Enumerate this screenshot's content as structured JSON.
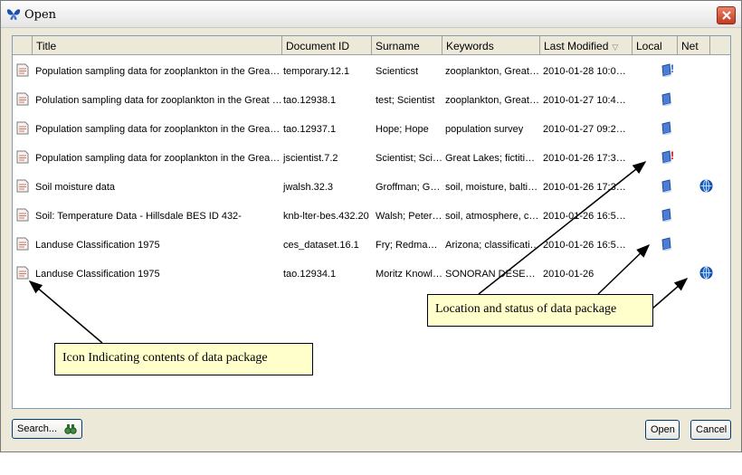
{
  "window": {
    "title": "Open",
    "app_icon": "butterfly-icon",
    "close_icon": "close-icon"
  },
  "table": {
    "columns": [
      {
        "key": "icon",
        "label": ""
      },
      {
        "key": "title",
        "label": "Title"
      },
      {
        "key": "doc_id",
        "label": "Document ID"
      },
      {
        "key": "surname",
        "label": "Surname"
      },
      {
        "key": "keywords",
        "label": "Keywords"
      },
      {
        "key": "modified",
        "label": "Last Modified"
      },
      {
        "key": "local",
        "label": "Local"
      },
      {
        "key": "net",
        "label": "Net"
      }
    ],
    "sort_icon": "▽",
    "rows": [
      {
        "title": "Population sampling data for zooplankton in the Great …",
        "doc_id": "temporary.12.1",
        "surname": "Scienticst",
        "keywords": "zooplankton, Great…",
        "modified": "2010-01-28 10:0…",
        "local": "local-warning",
        "net": ""
      },
      {
        "title": "Polulation sampling data for zooplankton in the Great …",
        "doc_id": "tao.12938.1",
        "surname": "test; Scientist",
        "keywords": "zooplankton, Great…",
        "modified": "2010-01-27 10:4…",
        "local": "local",
        "net": ""
      },
      {
        "title": "Population sampling data for zooplankton in the Great …",
        "doc_id": "tao.12937.1",
        "surname": "Hope; Hope",
        "keywords": "population survey",
        "modified": "2010-01-27 09:2…",
        "local": "local",
        "net": ""
      },
      {
        "title": "Population sampling data for zooplankton in the Great …",
        "doc_id": "jscientist.7.2",
        "surname": "Scientist; Sci…",
        "keywords": "Great Lakes; fictitio…",
        "modified": "2010-01-26 17:3…",
        "local": "local-error",
        "net": ""
      },
      {
        "title": "Soil moisture data",
        "doc_id": "jwalsh.32.3",
        "surname": "Groffman; G…",
        "keywords": "soil, moisture, balti…",
        "modified": "2010-01-26 17:3…",
        "local": "local",
        "net": "net"
      },
      {
        "title": "Soil: Temperature Data - Hillsdale BES ID 432-",
        "doc_id": "knb-lter-bes.432.20",
        "surname": "Walsh; Peter…",
        "keywords": "soil, atmosphere, c…",
        "modified": "2010-01-26 16:5…",
        "local": "local",
        "net": ""
      },
      {
        "title": "Landuse Classification 1975",
        "doc_id": "ces_dataset.16.1",
        "surname": "Fry; Redman…",
        "keywords": "Arizona; classificati…",
        "modified": "2010-01-26 16:5…",
        "local": "local",
        "net": ""
      },
      {
        "title": "Landuse Classification 1975",
        "doc_id": "tao.12934.1",
        "surname": "Moritz Knowl…",
        "keywords": "SONORAN DESERT…",
        "modified": "2010-01-26",
        "local": "",
        "net": "net"
      }
    ]
  },
  "callouts": {
    "icon_note": "Icon Indicating contents of data package",
    "location_note": "Location and status of data package"
  },
  "buttons": {
    "search_label": "Search...",
    "open_label": "Open",
    "cancel_label": "Cancel"
  },
  "colors": {
    "window_bg": "#ece9d8",
    "callout_bg": "#ffffcc",
    "net_blue": "#1b62c8",
    "error_red": "#d40000"
  }
}
